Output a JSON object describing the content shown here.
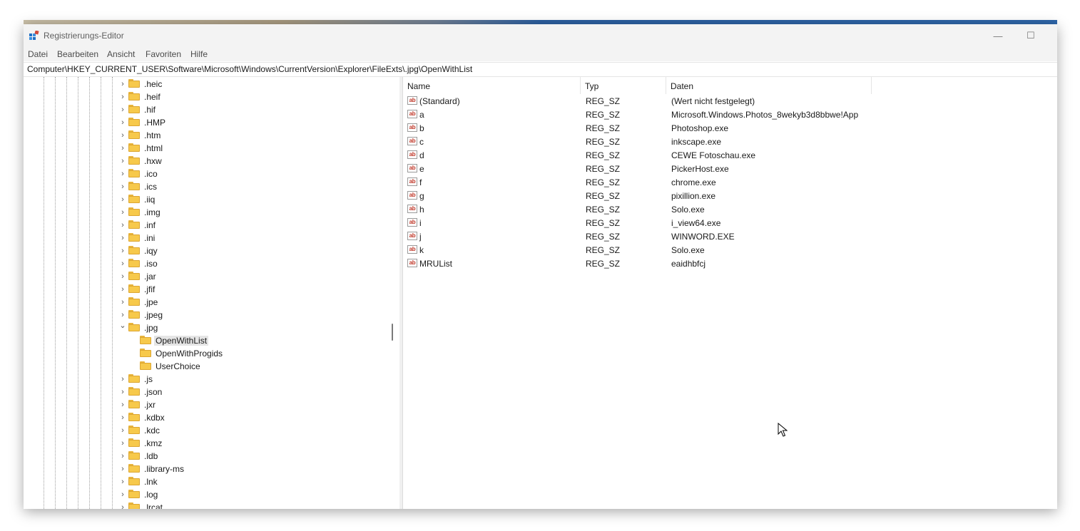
{
  "window": {
    "title": "Registrierungs-Editor",
    "minimize_glyph": "—",
    "maximize_glyph": "☐"
  },
  "menu": [
    "Datei",
    "Bearbeiten",
    "Ansicht",
    "Favoriten",
    "Hilfe"
  ],
  "address": "Computer\\HKEY_CURRENT_USER\\Software\\Microsoft\\Windows\\CurrentVersion\\Explorer\\FileExts\\.jpg\\OpenWithList",
  "tree": {
    "expander_closed": "›",
    "expander_open": "⌄",
    "items": [
      {
        "label": ".heic",
        "expander": "closed",
        "level": 0
      },
      {
        "label": ".heif",
        "expander": "closed",
        "level": 0
      },
      {
        "label": ".hif",
        "expander": "closed",
        "level": 0
      },
      {
        "label": ".HMP",
        "expander": "closed",
        "level": 0
      },
      {
        "label": ".htm",
        "expander": "closed",
        "level": 0
      },
      {
        "label": ".html",
        "expander": "closed",
        "level": 0
      },
      {
        "label": ".hxw",
        "expander": "closed",
        "level": 0
      },
      {
        "label": ".ico",
        "expander": "closed",
        "level": 0
      },
      {
        "label": ".ics",
        "expander": "closed",
        "level": 0
      },
      {
        "label": ".iiq",
        "expander": "closed",
        "level": 0
      },
      {
        "label": ".img",
        "expander": "closed",
        "level": 0
      },
      {
        "label": ".inf",
        "expander": "closed",
        "level": 0
      },
      {
        "label": ".ini",
        "expander": "closed",
        "level": 0
      },
      {
        "label": ".iqy",
        "expander": "closed",
        "level": 0
      },
      {
        "label": ".iso",
        "expander": "closed",
        "level": 0
      },
      {
        "label": ".jar",
        "expander": "closed",
        "level": 0
      },
      {
        "label": ".jfif",
        "expander": "closed",
        "level": 0
      },
      {
        "label": ".jpe",
        "expander": "closed",
        "level": 0
      },
      {
        "label": ".jpeg",
        "expander": "closed",
        "level": 0
      },
      {
        "label": ".jpg",
        "expander": "open",
        "level": 0
      },
      {
        "label": "OpenWithList",
        "expander": "none",
        "level": 1,
        "selected": true
      },
      {
        "label": "OpenWithProgids",
        "expander": "none",
        "level": 1
      },
      {
        "label": "UserChoice",
        "expander": "none",
        "level": 1
      },
      {
        "label": ".js",
        "expander": "closed",
        "level": 0
      },
      {
        "label": ".json",
        "expander": "closed",
        "level": 0
      },
      {
        "label": ".jxr",
        "expander": "closed",
        "level": 0
      },
      {
        "label": ".kdbx",
        "expander": "closed",
        "level": 0
      },
      {
        "label": ".kdc",
        "expander": "closed",
        "level": 0
      },
      {
        "label": ".kmz",
        "expander": "closed",
        "level": 0
      },
      {
        "label": ".ldb",
        "expander": "closed",
        "level": 0
      },
      {
        "label": ".library-ms",
        "expander": "closed",
        "level": 0
      },
      {
        "label": ".lnk",
        "expander": "closed",
        "level": 0
      },
      {
        "label": ".log",
        "expander": "closed",
        "level": 0
      },
      {
        "label": ".lrcat",
        "expander": "closed",
        "level": 0
      }
    ]
  },
  "columns": {
    "name": "Name",
    "type": "Typ",
    "data": "Daten"
  },
  "value_icon_text": "ab",
  "values": [
    {
      "name": "(Standard)",
      "type": "REG_SZ",
      "data": "(Wert nicht festgelegt)"
    },
    {
      "name": "a",
      "type": "REG_SZ",
      "data": "Microsoft.Windows.Photos_8wekyb3d8bbwe!App"
    },
    {
      "name": "b",
      "type": "REG_SZ",
      "data": "Photoshop.exe"
    },
    {
      "name": "c",
      "type": "REG_SZ",
      "data": "inkscape.exe"
    },
    {
      "name": "d",
      "type": "REG_SZ",
      "data": "CEWE Fotoschau.exe"
    },
    {
      "name": "e",
      "type": "REG_SZ",
      "data": "PickerHost.exe"
    },
    {
      "name": "f",
      "type": "REG_SZ",
      "data": "chrome.exe"
    },
    {
      "name": "g",
      "type": "REG_SZ",
      "data": "pixillion.exe"
    },
    {
      "name": "h",
      "type": "REG_SZ",
      "data": "Solo.exe"
    },
    {
      "name": "i",
      "type": "REG_SZ",
      "data": "i_view64.exe"
    },
    {
      "name": "j",
      "type": "REG_SZ",
      "data": "WINWORD.EXE"
    },
    {
      "name": "k",
      "type": "REG_SZ",
      "data": "Solo.exe"
    },
    {
      "name": "MRUList",
      "type": "REG_SZ",
      "data": "eaidhbfcj"
    }
  ],
  "colors": {
    "folder": "#f7c94b",
    "selection": "#e5e5e5",
    "value_icon": "#c0392b"
  }
}
